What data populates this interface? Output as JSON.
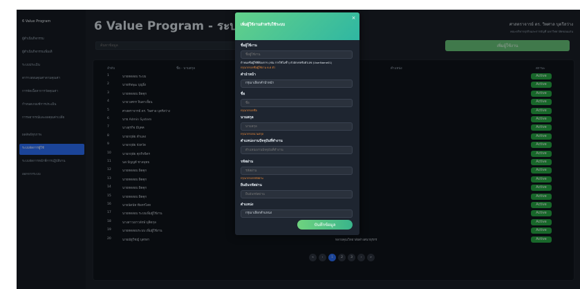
{
  "sidebar": {
    "brand": "6 Value Program",
    "items": [
      {
        "label": "ผู้ดำเนินกิจกรรม"
      },
      {
        "label": "ผู้ดำเนินกิจกรรมเพิ่มเติ"
      },
      {
        "label": "ระบบประเมิน"
      },
      {
        "label": "ตารางสอนคุณค่าตามคุณค่า"
      },
      {
        "label": "การจัดเนื้อหาการวัดคุณค่า"
      },
      {
        "label": "กำหนดเกณฑ์การประเมิน"
      },
      {
        "label": "การพยากรณ์และผลคุณค่าเปลี่ย"
      },
      {
        "label": "ผลลัพธ์ทุกภาพ"
      },
      {
        "label": "ระบบจัดการผู้ใช้"
      },
      {
        "label": "ระบบจัดการหน้าที่การปฏิบัติงาน"
      },
      {
        "label": "ออกจากระบบ"
      }
    ]
  },
  "header": {
    "title": "6 Value Program - ระบบจัดการผู้ใช้",
    "user_name": "ศาสตราจารย์ ดร. วิพศาล บุตรีสว่าง",
    "user_dept": "คณะบริหารธุรกิจและการบัญชี มหาวิทยาลัยขอนแก่น"
  },
  "search": {
    "placeholder": "ค้นหาข้อมูล"
  },
  "add_user_label": "เพิ่มผู้ใช้งาน",
  "table": {
    "headers": {
      "no": "ลำดับ",
      "name": "ชื่อ - นามสกุล",
      "position": "ตำแหน่ง",
      "status": "สถานะ"
    },
    "rows": [
      {
        "no": "1",
        "name": "นายทดสอบ ระบบ",
        "position": "",
        "status": "Active"
      },
      {
        "no": "2",
        "name": "นายทัพพุฒ บุญยิ่ง",
        "position": "",
        "status": "Active"
      },
      {
        "no": "3",
        "name": "นายทดสอบ ผิดคุก",
        "position": "",
        "status": "Active"
      },
      {
        "no": "4",
        "name": "นายวงศกร จินดาเจี้ยน",
        "position": "ไอท",
        "status": "Active"
      },
      {
        "no": "5",
        "name": "ศาสตราจารย์ ดร. วิพศาล บุตรีสว่าง",
        "position": "",
        "status": "Active"
      },
      {
        "no": "6",
        "name": "นาย Admin System",
        "position": "",
        "status": "Active"
      },
      {
        "no": "7",
        "name": "นางสุรกิจ มีบุคค",
        "position": "",
        "status": "Active"
      },
      {
        "no": "8",
        "name": "นายกฤษัย ดำแดง",
        "position": "",
        "status": "Active"
      },
      {
        "no": "9",
        "name": "นายกฤษัย จังหวัด",
        "position": "",
        "status": "Active"
      },
      {
        "no": "10",
        "name": "นายกฤษัย ศุภกิจจิตร",
        "position": "",
        "status": "Active"
      },
      {
        "no": "11",
        "name": "นส.ปัญญดี ชาลพุทธ",
        "position": "",
        "status": "Active"
      },
      {
        "no": "12",
        "name": "นายทดสอบ ผิดคุก",
        "position": "",
        "status": "Active"
      },
      {
        "no": "13",
        "name": "นายทดสอบ ผิดคุก",
        "position": "",
        "status": "Active"
      },
      {
        "no": "14",
        "name": "นายทดสอบ ผิดคุก",
        "position": "",
        "status": "Active"
      },
      {
        "no": "15",
        "name": "นายทดสอบ ผิดคุก",
        "position": "",
        "status": "Active"
      },
      {
        "no": "16",
        "name": "นายนัดนัท พีพหรไลท",
        "position": "",
        "status": "Active"
      },
      {
        "no": "17",
        "name": "นายทดสอบ ระบบเพิ่มผู้ใช้งาน",
        "position": "",
        "status": "Active"
      },
      {
        "no": "18",
        "name": "นางสาวเยาวลักษ์ มุสิตกุล",
        "position": "",
        "status": "Active"
      },
      {
        "no": "19",
        "name": "นายทดสอบระบบ เพิ่มผู้ใช้งาน",
        "position": "",
        "status": "Active"
      },
      {
        "no": "20",
        "name": "นายณัฐวิชญ์ บุตรสา",
        "position": "หลายคุณวิทยาลัยต่างสนาธุรกร",
        "status": "Active"
      }
    ]
  },
  "pagination": [
    "«",
    "‹",
    "1",
    "2",
    "3",
    "›",
    "»"
  ],
  "modal": {
    "title": "เพิ่มผู้ใช้งานสำหรับใช้ระบบ",
    "close_glyph": "×",
    "fields": {
      "username": {
        "label": "ชื่อผู้ใช้งาน",
        "placeholder": "ชื่อผู้ใช้งาน",
        "hint": "กำหนดชื่อผู้ใช้ที่ต้องการ (เช่น การใช้ไม่ซ้ำ) ตัวอักษรหรือตัวเลข (UserName01)",
        "error": "กรุณากรอกชื่อผู้ใช้งาน 6-8 ตัว"
      },
      "prefix": {
        "label": "คำนำหน้า",
        "value": "กรุณาเลือกคำนำหน้า"
      },
      "firstname": {
        "label": "ชื่อ",
        "placeholder": "ชื่อ",
        "error": "กรุณากรอกชื่อ"
      },
      "lastname": {
        "label": "นามสกุล",
        "placeholder": "นามสกุล",
        "error": "กรุณากรอกนามสกุล"
      },
      "department": {
        "label": "ตำแหน่งงานปัจจุบันที่ทำงาน",
        "placeholder": "ตำแหน่งงานปัจจุบันที่ทำงาน"
      },
      "password": {
        "label": "รหัสผ่าน",
        "placeholder": "รหัสผ่าน",
        "error": "กรุณากรอกรหัสผ่าน"
      },
      "confirm": {
        "label": "ยืนยันรหัสผ่าน",
        "placeholder": "ยืนยันรหัสผ่าน"
      },
      "role": {
        "label": "ตำแหน่ง",
        "value": "กรุณาเลือกตำแหน่ง"
      }
    },
    "save_label": "บันทึกข้อมูล"
  },
  "colors": {
    "accent": "#2c6ef5",
    "success": "#28a745",
    "modal_header": "#4cc49a",
    "error": "#f08c3a"
  }
}
